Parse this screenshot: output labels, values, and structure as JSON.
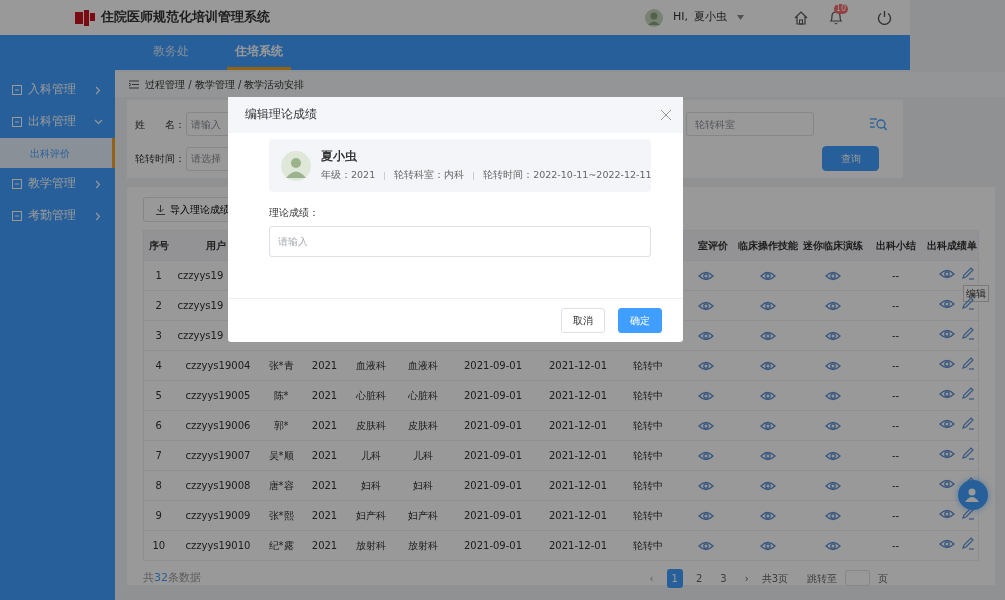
{
  "header": {
    "title": "住院医师规范化培训管理系统",
    "greeting": "HI,",
    "user": "夏小虫",
    "notification_count": "10"
  },
  "nav_tabs": [
    {
      "label": "教务处",
      "selected": false
    },
    {
      "label": "住培系统",
      "selected": true
    }
  ],
  "sidebar": [
    {
      "label": "入科管理",
      "expanded": false
    },
    {
      "label": "出科管理",
      "expanded": true,
      "children": [
        {
          "label": "出科评价",
          "selected": true
        }
      ]
    },
    {
      "label": "教学管理",
      "expanded": false
    },
    {
      "label": "考勤管理",
      "expanded": false
    }
  ],
  "breadcrumb": "过程管理 / 教学管理 / 教学活动安排",
  "filters": {
    "name_label": "姓　　名：",
    "name_placeholder": "请输入",
    "dept_placeholder": "轮转科室",
    "time_label": "轮转时间：",
    "time_placeholder": "请选择",
    "search_button": "查询"
  },
  "import_button": "导入理论成绩",
  "table": {
    "columns": [
      "序号",
      "用户",
      "",
      "",
      "",
      "",
      "",
      "",
      "",
      "室评价",
      "临床操作技能",
      "迷你临床演练",
      "出科小结",
      "出科成绩单"
    ],
    "rows": [
      {
        "no": "1",
        "username": "czzyys19",
        "summary": "--",
        "tooltip": "编辑"
      },
      {
        "no": "2",
        "username": "czzyys19",
        "summary": "--"
      },
      {
        "no": "3",
        "username": "czzyys19",
        "summary": "--"
      },
      {
        "no": "4",
        "username": "czzyys19004",
        "name": "张*青",
        "grade": "2021",
        "dept": "血液科",
        "dept2": "血液科",
        "start": "2021-09-01",
        "end": "2021-12-01",
        "status": "轮转中",
        "summary": "--"
      },
      {
        "no": "5",
        "username": "czzyys19005",
        "name": "陈*",
        "grade": "2021",
        "dept": "心脏科",
        "dept2": "心脏科",
        "start": "2021-09-01",
        "end": "2021-12-01",
        "status": "轮转中",
        "summary": "--"
      },
      {
        "no": "6",
        "username": "czzyys19006",
        "name": "郭*",
        "grade": "2021",
        "dept": "皮肤科",
        "dept2": "皮肤科",
        "start": "2021-09-01",
        "end": "2021-12-01",
        "status": "轮转中",
        "summary": "--"
      },
      {
        "no": "7",
        "username": "czzyys19007",
        "name": "吴*顺",
        "grade": "2021",
        "dept": "儿科",
        "dept2": "儿科",
        "start": "2021-09-01",
        "end": "2021-12-01",
        "status": "轮转中",
        "summary": "--"
      },
      {
        "no": "8",
        "username": "czzyys19008",
        "name": "唐*容",
        "grade": "2021",
        "dept": "妇科",
        "dept2": "妇科",
        "start": "2021-09-01",
        "end": "2021-12-01",
        "status": "轮转中",
        "summary": "--"
      },
      {
        "no": "9",
        "username": "czzyys19009",
        "name": "张*熙",
        "grade": "2021",
        "dept": "妇产科",
        "dept2": "妇产科",
        "start": "2021-09-01",
        "end": "2021-12-01",
        "status": "轮转中",
        "summary": "--"
      },
      {
        "no": "10",
        "username": "czzyys19010",
        "name": "纪*露",
        "grade": "2021",
        "dept": "放射科",
        "dept2": "放射科",
        "start": "2021-09-01",
        "end": "2021-12-01",
        "status": "轮转中",
        "summary": "--"
      }
    ]
  },
  "total": {
    "prefix": "共",
    "count": "32",
    "suffix": "条数据"
  },
  "pagination": {
    "prev": "‹",
    "pages": [
      {
        "label": "1",
        "selected": true
      },
      {
        "label": "2",
        "selected": false
      },
      {
        "label": "3",
        "selected": false
      }
    ],
    "next": "›",
    "total_pages": "共3页",
    "jump_label": "跳转至",
    "page_unit": "页"
  },
  "modal": {
    "title": "编辑理论成绩",
    "student": {
      "name": "夏小虫",
      "grade": "年级：2021",
      "dept": "轮转科室：内科",
      "period": "轮转时间：2022-10-11~2022-12-11"
    },
    "field_label": "理论成绩：",
    "placeholder": "请输入",
    "buttons": [
      {
        "label": "取消",
        "kind": "default"
      },
      {
        "label": "确定",
        "kind": "primary"
      }
    ]
  }
}
